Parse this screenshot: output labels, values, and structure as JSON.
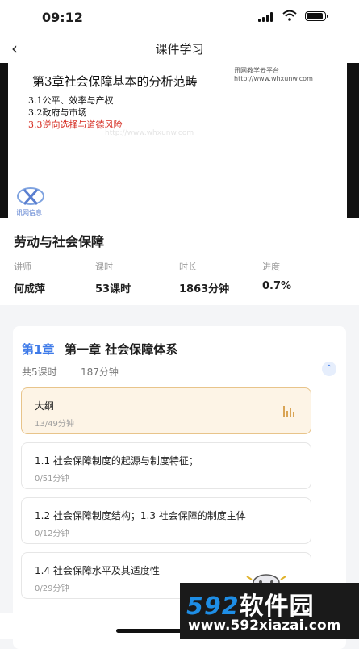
{
  "status_bar": {
    "time": "09:12"
  },
  "nav": {
    "title": "课件学习"
  },
  "slide": {
    "heading": "第3章社会保障基本的分析范畴",
    "watermark_line1": "讯网教学云平台",
    "watermark_line2": "http://www.whxunw.com",
    "items": [
      "3.1公平、效率与产权",
      "3.2政府与市场",
      "3.3逆向选择与道德风险"
    ],
    "center_watermark": "http://www.whxunw.com",
    "logo_text": "讯网信息"
  },
  "course": {
    "name": "劳动与社会保障",
    "stats": [
      {
        "label": "讲师",
        "value": "何成萍"
      },
      {
        "label": "课时",
        "value": "53课时"
      },
      {
        "label": "时长",
        "value": "1863分钟"
      },
      {
        "label": "进度",
        "value": "0.7%"
      }
    ]
  },
  "chapter": {
    "number": "第1章",
    "title": "第一章 社会保障体系",
    "lesson_count": "共5课时",
    "duration": "187分钟",
    "lessons": [
      {
        "name": "大纲",
        "detail": "13/49分钟",
        "active": true
      },
      {
        "name": "1.1 社会保障制度的起源与制度特征；",
        "detail": "0/51分钟"
      },
      {
        "name": "1.2 社会保障制度结构；1.3 社会保障的制度主体",
        "detail": "0/12分钟"
      },
      {
        "name": "1.4 社会保障水平及其适度性",
        "detail": "0/29分钟"
      }
    ]
  },
  "watermark_banner": {
    "line1_digits": "592",
    "line1_text": "软件园",
    "line2": "www.592xiazai.com"
  },
  "colors": {
    "accent": "#3f7be9",
    "active_bg": "#fdf4e6",
    "active_border": "#e8c48a",
    "highlight_red": "#d52a1f"
  }
}
